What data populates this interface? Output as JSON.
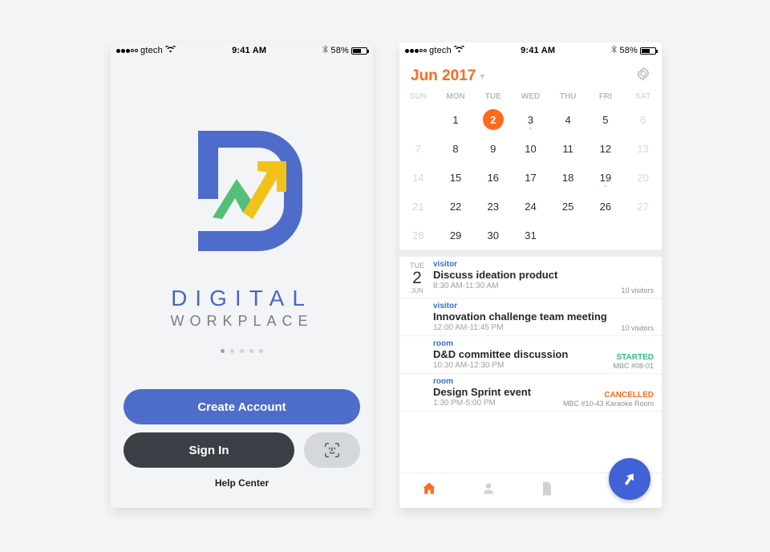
{
  "status": {
    "carrier": "gtech",
    "time": "9:41 AM",
    "battery": "58%"
  },
  "welcome": {
    "brand_top": "DIGITAL",
    "brand_bottom": "WORKPLACE",
    "create": "Create Account",
    "signin": "Sign In",
    "help": "Help Center"
  },
  "calendar": {
    "title": "Jun 2017",
    "dow": [
      "SUN",
      "MON",
      "TUE",
      "WED",
      "THU",
      "FRI",
      "SAT"
    ],
    "rows": [
      [
        {
          "n": "",
          "out": true
        },
        {
          "n": "1"
        },
        {
          "n": "2",
          "sel": true,
          "mark": true
        },
        {
          "n": "3",
          "mark": true
        },
        {
          "n": "4"
        },
        {
          "n": "5"
        },
        {
          "n": "6",
          "out": true
        }
      ],
      [
        {
          "n": "7",
          "out": true
        },
        {
          "n": "8"
        },
        {
          "n": "9"
        },
        {
          "n": "10"
        },
        {
          "n": "11"
        },
        {
          "n": "12"
        },
        {
          "n": "13",
          "out": true
        }
      ],
      [
        {
          "n": "14",
          "out": true
        },
        {
          "n": "15"
        },
        {
          "n": "16"
        },
        {
          "n": "17"
        },
        {
          "n": "18"
        },
        {
          "n": "19",
          "mark": true
        },
        {
          "n": "20",
          "out": true
        }
      ],
      [
        {
          "n": "21",
          "out": true
        },
        {
          "n": "22"
        },
        {
          "n": "23"
        },
        {
          "n": "24"
        },
        {
          "n": "25"
        },
        {
          "n": "26"
        },
        {
          "n": "27",
          "out": true
        }
      ],
      [
        {
          "n": "28",
          "out": true
        },
        {
          "n": "29"
        },
        {
          "n": "30"
        },
        {
          "n": "31"
        },
        {
          "n": "",
          "out": true
        },
        {
          "n": "",
          "out": true
        },
        {
          "n": "",
          "out": true
        }
      ]
    ]
  },
  "agenda_date": {
    "dow": "TUE",
    "day": "2",
    "mon": "JUN"
  },
  "agenda": [
    {
      "tag": "visitor",
      "title": "Discuss ideation product",
      "time": "8:30 AM-11:30 AM",
      "status": "",
      "loc": "10 visitors"
    },
    {
      "tag": "visitor",
      "title": "Innovation challenge team meeting",
      "time": "12:00 AM-11:45 PM",
      "status": "",
      "loc": "10 visitors"
    },
    {
      "tag": "room",
      "title": "D&D committee discussion",
      "time": "10:30 AM-12:30 PM",
      "status": "STARTED",
      "loc": "MBC #08-01"
    },
    {
      "tag": "room",
      "title": "Design Sprint event",
      "time": "1:30 PM-5:00 PM",
      "status": "CANCELLED",
      "loc": "MBC #10-43 Karaoke Room"
    }
  ]
}
